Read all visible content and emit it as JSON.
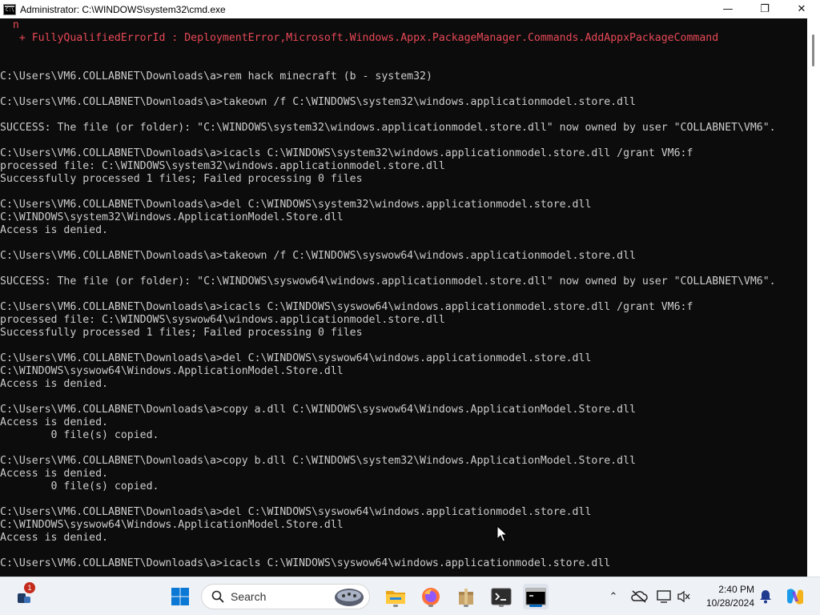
{
  "window": {
    "title": "Administrator: C:\\WINDOWS\\system32\\cmd.exe",
    "app_icon_text": "C:\\",
    "minimize_glyph": "—",
    "maximize_glyph": "❐",
    "close_glyph": "✕"
  },
  "console": {
    "lines": [
      {
        "text": "  n",
        "type": "error"
      },
      {
        "text": "   + FullyQualifiedErrorId : DeploymentError,Microsoft.Windows.Appx.PackageManager.Commands.AddAppxPackageCommand",
        "type": "error"
      },
      {
        "text": "",
        "type": "normal"
      },
      {
        "text": "",
        "type": "normal"
      },
      {
        "text": "C:\\Users\\VM6.COLLABNET\\Downloads\\a>rem hack minecraft (b - system32)",
        "type": "normal"
      },
      {
        "text": "",
        "type": "normal"
      },
      {
        "text": "C:\\Users\\VM6.COLLABNET\\Downloads\\a>takeown /f C:\\WINDOWS\\system32\\windows.applicationmodel.store.dll",
        "type": "normal"
      },
      {
        "text": "",
        "type": "normal"
      },
      {
        "text": "SUCCESS: The file (or folder): \"C:\\WINDOWS\\system32\\windows.applicationmodel.store.dll\" now owned by user \"COLLABNET\\VM6\".",
        "type": "normal"
      },
      {
        "text": "",
        "type": "normal"
      },
      {
        "text": "C:\\Users\\VM6.COLLABNET\\Downloads\\a>icacls C:\\WINDOWS\\system32\\windows.applicationmodel.store.dll /grant VM6:f",
        "type": "normal"
      },
      {
        "text": "processed file: C:\\WINDOWS\\system32\\windows.applicationmodel.store.dll",
        "type": "normal"
      },
      {
        "text": "Successfully processed 1 files; Failed processing 0 files",
        "type": "normal"
      },
      {
        "text": "",
        "type": "normal"
      },
      {
        "text": "C:\\Users\\VM6.COLLABNET\\Downloads\\a>del C:\\WINDOWS\\system32\\windows.applicationmodel.store.dll",
        "type": "normal"
      },
      {
        "text": "C:\\WINDOWS\\system32\\Windows.ApplicationModel.Store.dll",
        "type": "normal"
      },
      {
        "text": "Access is denied.",
        "type": "normal"
      },
      {
        "text": "",
        "type": "normal"
      },
      {
        "text": "C:\\Users\\VM6.COLLABNET\\Downloads\\a>takeown /f C:\\WINDOWS\\syswow64\\windows.applicationmodel.store.dll",
        "type": "normal"
      },
      {
        "text": "",
        "type": "normal"
      },
      {
        "text": "SUCCESS: The file (or folder): \"C:\\WINDOWS\\syswow64\\windows.applicationmodel.store.dll\" now owned by user \"COLLABNET\\VM6\".",
        "type": "normal"
      },
      {
        "text": "",
        "type": "normal"
      },
      {
        "text": "C:\\Users\\VM6.COLLABNET\\Downloads\\a>icacls C:\\WINDOWS\\syswow64\\windows.applicationmodel.store.dll /grant VM6:f",
        "type": "normal"
      },
      {
        "text": "processed file: C:\\WINDOWS\\syswow64\\windows.applicationmodel.store.dll",
        "type": "normal"
      },
      {
        "text": "Successfully processed 1 files; Failed processing 0 files",
        "type": "normal"
      },
      {
        "text": "",
        "type": "normal"
      },
      {
        "text": "C:\\Users\\VM6.COLLABNET\\Downloads\\a>del C:\\WINDOWS\\syswow64\\windows.applicationmodel.store.dll",
        "type": "normal"
      },
      {
        "text": "C:\\WINDOWS\\syswow64\\Windows.ApplicationModel.Store.dll",
        "type": "normal"
      },
      {
        "text": "Access is denied.",
        "type": "normal"
      },
      {
        "text": "",
        "type": "normal"
      },
      {
        "text": "C:\\Users\\VM6.COLLABNET\\Downloads\\a>copy a.dll C:\\WINDOWS\\syswow64\\Windows.ApplicationModel.Store.dll",
        "type": "normal"
      },
      {
        "text": "Access is denied.",
        "type": "normal"
      },
      {
        "text": "        0 file(s) copied.",
        "type": "normal"
      },
      {
        "text": "",
        "type": "normal"
      },
      {
        "text": "C:\\Users\\VM6.COLLABNET\\Downloads\\a>copy b.dll C:\\WINDOWS\\system32\\Windows.ApplicationModel.Store.dll",
        "type": "normal"
      },
      {
        "text": "Access is denied.",
        "type": "normal"
      },
      {
        "text": "        0 file(s) copied.",
        "type": "normal"
      },
      {
        "text": "",
        "type": "normal"
      },
      {
        "text": "C:\\Users\\VM6.COLLABNET\\Downloads\\a>del C:\\WINDOWS\\syswow64\\windows.applicationmodel.store.dll",
        "type": "normal"
      },
      {
        "text": "C:\\WINDOWS\\syswow64\\Windows.ApplicationModel.Store.dll",
        "type": "normal"
      },
      {
        "text": "Access is denied.",
        "type": "normal"
      },
      {
        "text": "",
        "type": "normal"
      },
      {
        "text": "C:\\Users\\VM6.COLLABNET\\Downloads\\a>icacls C:\\WINDOWS\\syswow64\\windows.applicationmodel.store.dll",
        "type": "normal"
      }
    ],
    "colors": {
      "background": "#0c0c0c",
      "text": "#cccccc",
      "error": "#e74856"
    }
  },
  "taskbar": {
    "widget_badge": "1",
    "search_label": "Search",
    "apps": [
      {
        "name": "start-button",
        "icon": "windows-logo-icon"
      },
      {
        "name": "search-box",
        "icon": "search-icon"
      },
      {
        "name": "widgets-app",
        "icon": "widgets-icon"
      },
      {
        "name": "file-explorer",
        "icon": "folder-icon"
      },
      {
        "name": "firefox",
        "icon": "firefox-icon"
      },
      {
        "name": "store-app",
        "icon": "package-icon"
      },
      {
        "name": "terminal",
        "icon": "terminal-icon"
      },
      {
        "name": "cmd",
        "icon": "cmd-icon"
      }
    ],
    "tray": {
      "chevron_glyph": "⌃",
      "time": "2:40 PM",
      "date": "10/28/2024"
    }
  }
}
